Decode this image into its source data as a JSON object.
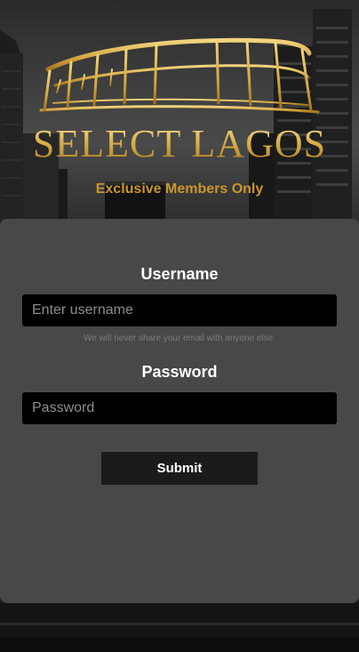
{
  "brand": {
    "title": "SELECT LAGOS",
    "tagline": "Exclusive Members Only",
    "logo_icon": "stadium-icon",
    "gold": "#d4a73f",
    "tagline_color": "#c9962d"
  },
  "form": {
    "username_label": "Username",
    "username_placeholder": "Enter username",
    "username_help": "We will never share your email with anyone else.",
    "password_label": "Password",
    "password_placeholder": "Password",
    "submit_label": "Submit"
  },
  "colors": {
    "panel": "#474849",
    "input_bg": "#000000",
    "button_bg": "#1b1b1b"
  }
}
